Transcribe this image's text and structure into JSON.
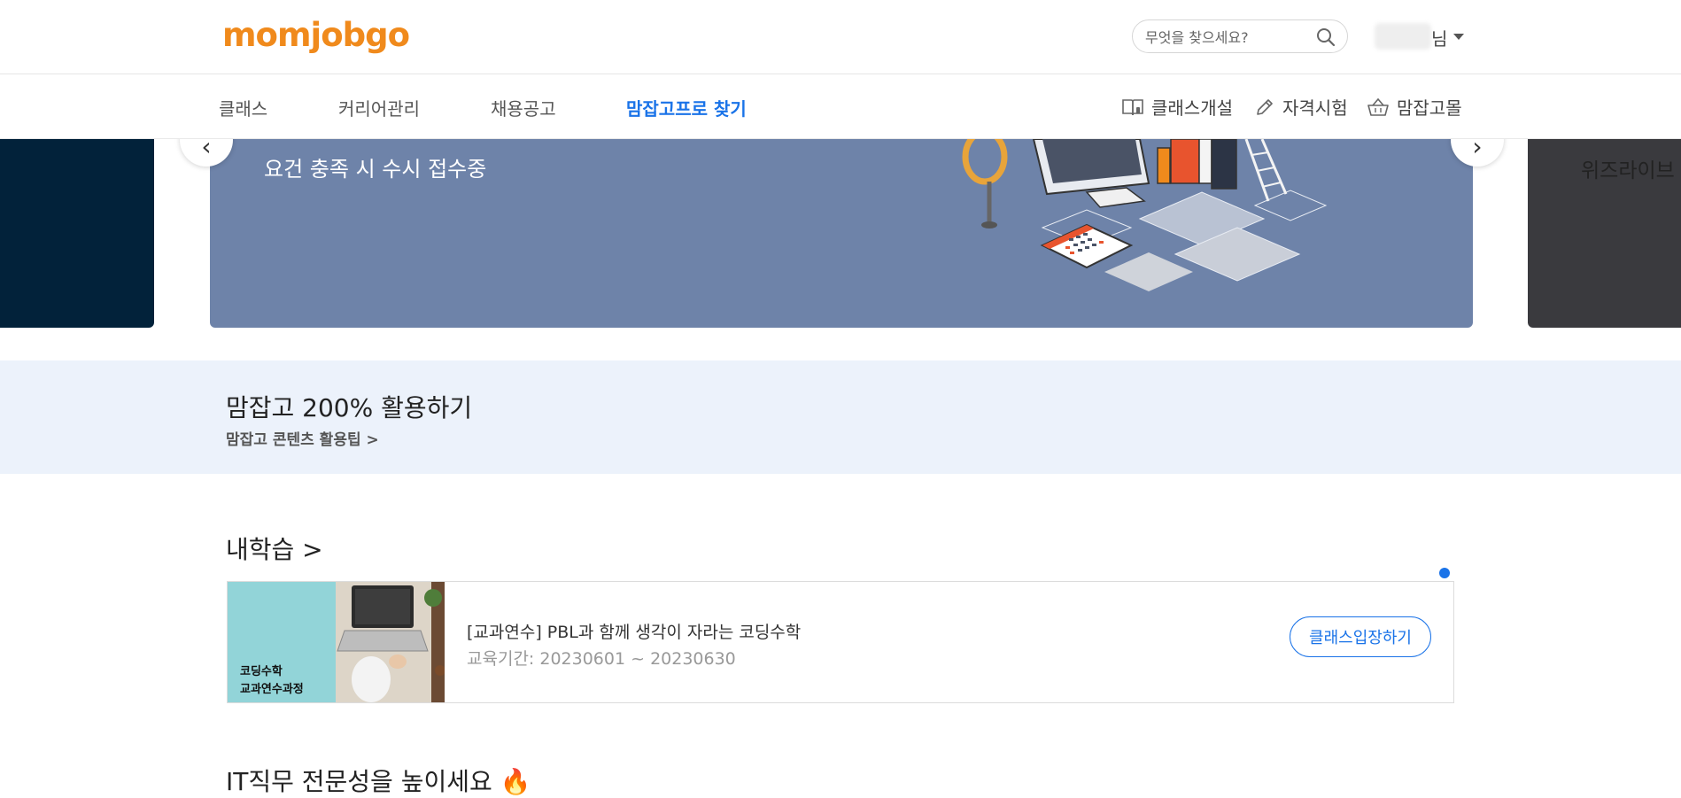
{
  "header": {
    "logo": "momjobgo",
    "search_placeholder": "무엇을 찾으세요?",
    "user_suffix": "님"
  },
  "nav": {
    "items": [
      {
        "label": "클래스"
      },
      {
        "label": "커리어관리"
      },
      {
        "label": "채용공고"
      },
      {
        "label": "맘잡고프로 찾기"
      }
    ],
    "active_index": 3,
    "utilities": [
      {
        "label": "클래스개설",
        "icon": "book-icon"
      },
      {
        "label": "자격시험",
        "icon": "pencil-icon"
      },
      {
        "label": "맘잡고몰",
        "icon": "basket-icon"
      }
    ]
  },
  "banner": {
    "main_text": "요건 충족 시 수시 접수중",
    "next_peek_text": "위즈라이브",
    "prev_arrow": "‹",
    "next_arrow": "›"
  },
  "tips": {
    "title": "맘잡고 200% 활용하기",
    "subtitle": "맘잡고 콘텐츠 활용팁 >"
  },
  "my_learning": {
    "heading": "내학습 >",
    "course": {
      "thumb_line1": "코딩수학",
      "thumb_line2": "교과연수과정",
      "title": "[교과연수] PBL과 함께 생각이 자라는 코딩수학",
      "period": "교육기간: 20230601 ~ 20230630",
      "button": "클래스입장하기"
    }
  },
  "it_section": {
    "heading": "IT직무 전문성을 높이세요 🔥"
  },
  "colors": {
    "brand_orange": "#f08a1c",
    "accent_blue": "#1a73e8",
    "banner_main": "#6e83a9",
    "banner_left": "#02223a",
    "banner_right": "#3a3a3e",
    "tips_bg": "#ecf2fb"
  }
}
